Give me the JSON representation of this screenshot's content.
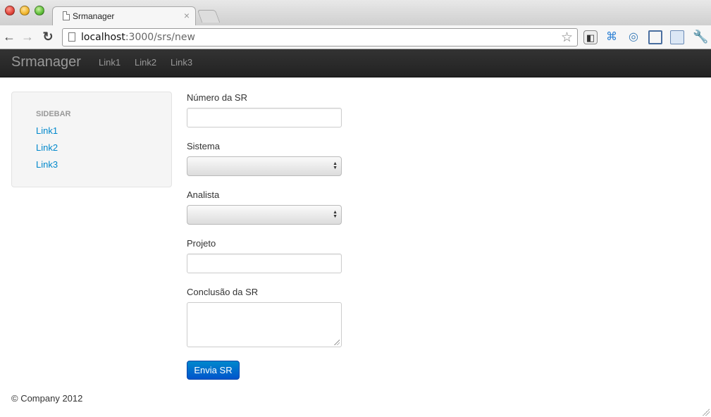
{
  "browser": {
    "tab_title": "Srmanager",
    "tab_close": "×",
    "url_host": "localhost",
    "url_path": ":3000/srs/new",
    "nav_back": "←",
    "nav_forward": "→",
    "nav_reload": "↻",
    "star": "☆",
    "wrench": "🔧",
    "ext_glyph2": "⌘",
    "ext_glyph3": "◎"
  },
  "navbar": {
    "brand": "Srmanager",
    "links": [
      "Link1",
      "Link2",
      "Link3"
    ]
  },
  "sidebar": {
    "header": "SIDEBAR",
    "links": [
      "Link1",
      "Link2",
      "Link3"
    ]
  },
  "form": {
    "numero_label": "Número da SR",
    "numero_value": "",
    "sistema_label": "Sistema",
    "sistema_selected": "",
    "analista_label": "Analista",
    "analista_selected": "",
    "projeto_label": "Projeto",
    "projeto_value": "",
    "conclusao_label": "Conclusão da SR",
    "conclusao_value": "",
    "submit_label": "Envia SR"
  },
  "footer": {
    "text": "© Company 2012"
  },
  "colors": {
    "link": "#0088cc",
    "navbar_bg": "#222222",
    "primary_button": "#0066cc"
  }
}
